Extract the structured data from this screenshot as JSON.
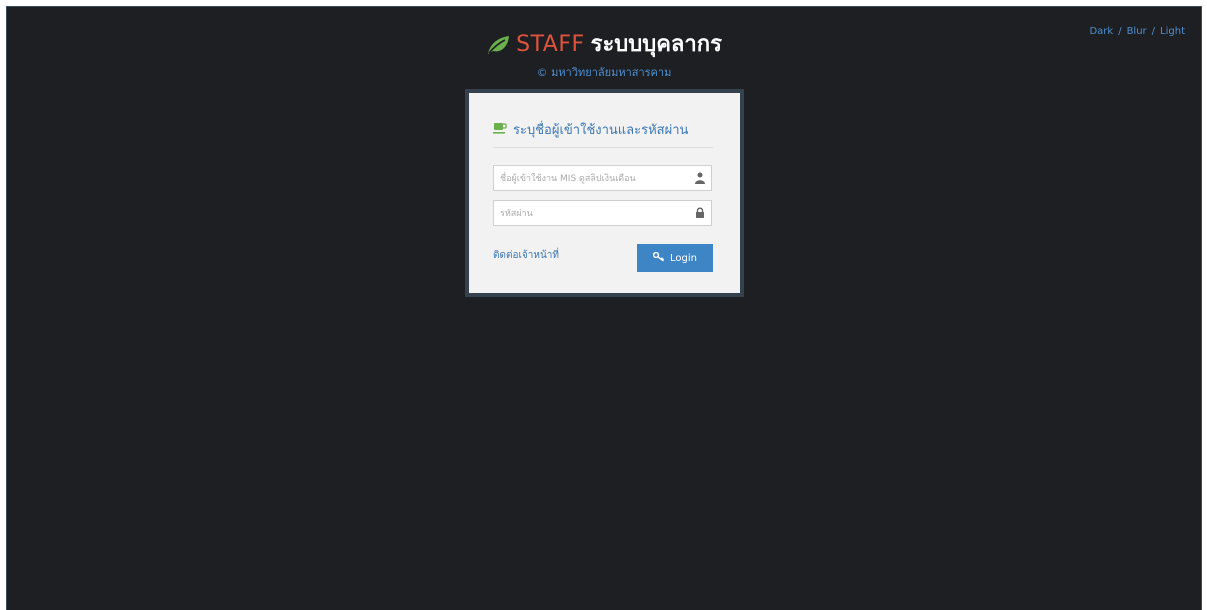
{
  "theme_switcher": {
    "dark": "Dark",
    "blur": "Blur",
    "light": "Light",
    "separator": "/"
  },
  "brand": {
    "staff": "STAFF",
    "system": "ระบบบุคลากร",
    "subtitle": "© มหาวิทยาลัยมหาสารคาม",
    "icons": {
      "logo": "leaf-icon"
    },
    "colors": {
      "staff": "#e0533c",
      "leaf": "#6ab04c",
      "accent": "#4e8fd0"
    }
  },
  "login": {
    "heading": "ระบุชื่อผู้เข้าใช้งานและรหัสผ่าน",
    "username": {
      "value": "",
      "placeholder": "ชื่อผู้เข้าใช้งาน MIS ดูสลิปเงินเดือน",
      "icon": "user-icon"
    },
    "password": {
      "value": "",
      "placeholder": "รหัสผ่าน",
      "icon": "lock-icon"
    },
    "contact_link": "ติดต่อเจ้าหน้าที่",
    "login_button": "Login",
    "icons": {
      "heading": "cup-icon",
      "button": "key-icon"
    },
    "colors": {
      "button": "#3e85c6",
      "heading_icon": "#6ab04c"
    }
  }
}
